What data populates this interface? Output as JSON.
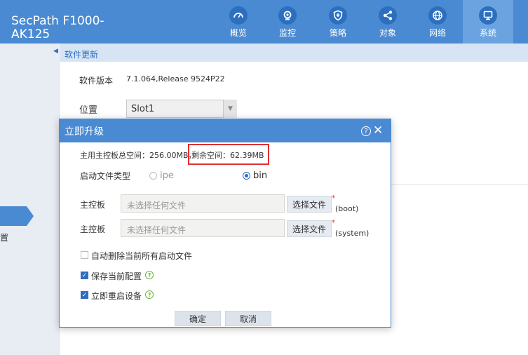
{
  "header": {
    "logo_line1": "SecPath F1000-",
    "logo_line2": "AK125",
    "nav": [
      {
        "label": "概览",
        "icon": "dashboard-icon"
      },
      {
        "label": "监控",
        "icon": "monitor-icon"
      },
      {
        "label": "策略",
        "icon": "shield-icon"
      },
      {
        "label": "对象",
        "icon": "share-nodes-icon"
      },
      {
        "label": "网络",
        "icon": "globe-icon"
      },
      {
        "label": "系统",
        "icon": "system-screen-icon",
        "active": true
      }
    ]
  },
  "sidebar": {
    "partial_text": "置"
  },
  "breadcrumb": {
    "title": "软件更新"
  },
  "main": {
    "version_label": "软件版本",
    "version_value": "7.1.064,Release 9524P22",
    "location_label": "位置",
    "location_value": "Slot1"
  },
  "modal": {
    "title": "立即升级",
    "total_space": "主用主控板总空间：256.00MB，",
    "remaining_space": "剩余空间：62.39MB",
    "boot_type_label": "启动文件类型",
    "option_ipe": "ipe",
    "option_bin": "bin",
    "selected_type": "bin",
    "mainboard_label": "主控板",
    "file_placeholder": "未选择任何文件",
    "choose_file": "选择文件",
    "boot_suffix": "(boot)",
    "system_suffix": "(system)",
    "auto_delete_label": "自动删除当前所有启动文件",
    "auto_delete_checked": false,
    "save_config_label": "保存当前配置",
    "save_config_checked": true,
    "reboot_label": "立即重启设备",
    "reboot_checked": true,
    "ok_label": "确定",
    "cancel_label": "取消"
  },
  "colors": {
    "header": "#4a8ad2",
    "accent": "#2d6fbf",
    "highlight_border": "#e03030",
    "help_green": "#6cb33f"
  }
}
